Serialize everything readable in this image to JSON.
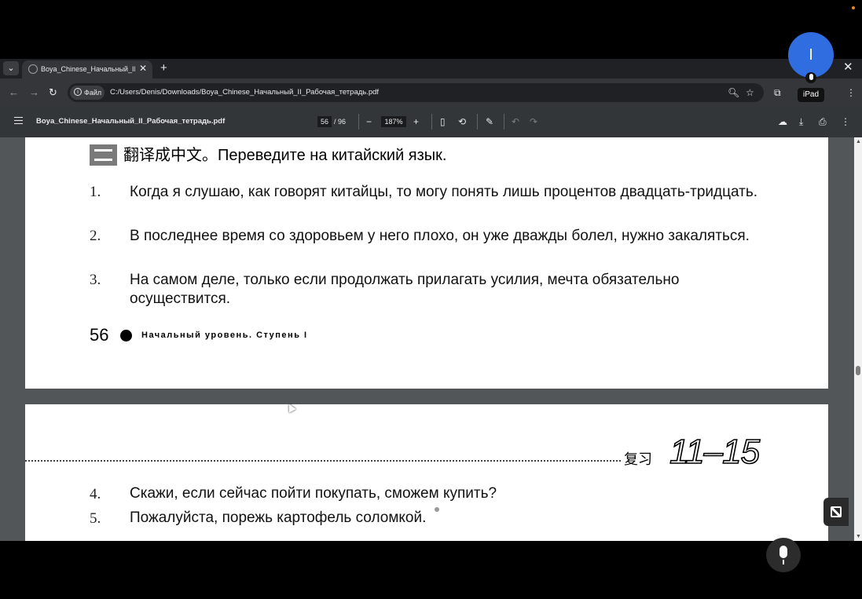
{
  "browser": {
    "tab_title": "Boya_Chinese_Начальный_II_Р",
    "url_chip": "Файл",
    "url": "C:/Users/Denis/Downloads/Boya_Chinese_Начальный_II_Рабочая_тетрадь.pdf",
    "icons": [
      "tab-search-icon",
      "back-icon",
      "forward-icon",
      "reload-icon",
      "zoom-icon",
      "star-icon",
      "extensions-icon",
      "menu-icon"
    ]
  },
  "pdf_viewer": {
    "filename": "Boya_Chinese_Начальный_II_Рабочая_тетрадь.pdf",
    "current_page": "56",
    "total_pages": "/ 96",
    "zoom": "187%"
  },
  "page56": {
    "section_title": "翻译成中文。Переведите на китайский язык.",
    "items": [
      {
        "num": "1.",
        "text": "Когда я слушаю, как говорят китайцы, то могу понять лишь процентов двадцать-тридцать."
      },
      {
        "num": "2.",
        "text": "В последнее время со здоровьем у него плохо, он уже дважды болел, нужно закаляться."
      },
      {
        "num": "3.",
        "text": "На самом деле, только если продолжать прилагать усилия, мечта обязательно осуществится."
      }
    ],
    "page_number": "56",
    "footer": "Начальный уровень. Ступень I"
  },
  "page57": {
    "review_label": "复习",
    "review_range": "11–15",
    "items": [
      {
        "num": "4.",
        "text": "Скажи, если сейчас пойти покупать, сможем купить?"
      },
      {
        "num": "5.",
        "text": "Пожалуйста, порежь картофель соломкой."
      }
    ]
  },
  "overlay": {
    "avatar_letter": "I",
    "device_label": "iPad"
  },
  "colors": {
    "avatar": "#2f6de1",
    "pdf_toolbar": "#323639",
    "viewer_bg": "#525659"
  }
}
